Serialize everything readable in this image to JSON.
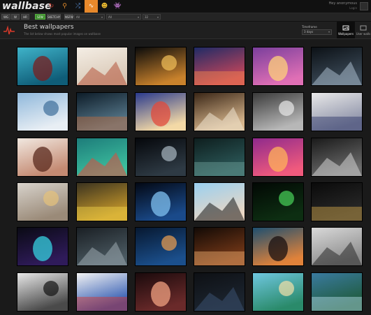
{
  "brand": {
    "logo": "wallbase"
  },
  "topbar": {
    "nav_icons": [
      {
        "name": "refresh-icon",
        "glyph": "↻",
        "color": "#c0392b"
      },
      {
        "name": "search-icon",
        "glyph": "⚲",
        "color": "#e08a2b"
      },
      {
        "name": "shuffle-icon",
        "glyph": "⤮",
        "color": "#5b8fd6"
      },
      {
        "name": "toplist-pulse-icon",
        "glyph": "∿",
        "color": "#ffffff",
        "active": true
      },
      {
        "name": "random-face-icon",
        "glyph": "☻",
        "color": "#e8b830"
      },
      {
        "name": "alien-icon",
        "glyph": "👾",
        "color": "#4fb04f"
      }
    ],
    "user": {
      "name": "Hey anonymous",
      "link": "Login"
    }
  },
  "filters": {
    "purity_buttons": [
      {
        "label": "WG",
        "on": false
      },
      {
        "label": "W",
        "on": false
      },
      {
        "label": "HR",
        "on": false
      },
      {
        "label": "SFW",
        "on": true
      },
      {
        "label": "SKETCHY",
        "on": true
      },
      {
        "label": "NSFW",
        "on": false
      }
    ],
    "selects": [
      {
        "label": "All",
        "name": "resolution-select"
      },
      {
        "label": "All",
        "name": "aspect-select"
      },
      {
        "label": "32",
        "name": "per-page-select"
      }
    ]
  },
  "header": {
    "title": "Best wallpapers",
    "subtitle": "The list below shows most popular images on wallbase",
    "timeframe_label": "Timeframe",
    "timeframe_value": "3 days",
    "tabs": [
      {
        "label": "Wallpapers",
        "active": true
      },
      {
        "label": "User walls",
        "active": false
      }
    ]
  },
  "thumbnails": [
    {
      "subject": "red-haired girl in pool",
      "c1": "#3fb3c9",
      "c2": "#0f5d78",
      "accent": "#7a1f1f"
    },
    {
      "subject": "red-haired girl lying in white",
      "c1": "#f4eee5",
      "c2": "#d9c8b6",
      "accent": "#b5533a"
    },
    {
      "subject": "golden clouds at sunset",
      "c1": "#0b0b0b",
      "c2": "#c9822c",
      "accent": "#f2c05a"
    },
    {
      "subject": "blue sea sunset with red sky",
      "c1": "#1f2b66",
      "c2": "#c9465a",
      "accent": "#f58a4b"
    },
    {
      "subject": "purple pink abstract sky",
      "c1": "#7a3f9c",
      "c2": "#e06fb5",
      "accent": "#ffd17a"
    },
    {
      "subject": "dark cityscape storm",
      "c1": "#0c1116",
      "c2": "#3d4c5a",
      "accent": "#a6b8c8"
    },
    {
      "subject": "snowy mountain range",
      "c1": "#8fb8db",
      "c2": "#e8eef4",
      "accent": "#3d6e9a"
    },
    {
      "subject": "chrome robot head",
      "c1": "#0d1c28",
      "c2": "#5b7d90",
      "accent": "#c06a3a"
    },
    {
      "subject": "beach cartoon scene",
      "c1": "#2a3a8c",
      "c2": "#f3d9a6",
      "accent": "#e24a3b"
    },
    {
      "subject": "fantasy blonde warrior",
      "c1": "#3a2616",
      "c2": "#d6b58c",
      "accent": "#efe4d0"
    },
    {
      "subject": "grey foggy city ruins",
      "c1": "#3a3a3a",
      "c2": "#b7b7b7",
      "accent": "#e8e8e8"
    },
    {
      "subject": "white armored knight",
      "c1": "#e9e9e9",
      "c2": "#8a8fa6",
      "accent": "#2a3266"
    },
    {
      "subject": "brunette girl",
      "c1": "#f1e8e0",
      "c2": "#c48a72",
      "accent": "#5a2a1e"
    },
    {
      "subject": "teal red feather leaves",
      "c1": "#1d7c7a",
      "c2": "#3dbf9e",
      "accent": "#e2493b"
    },
    {
      "subject": "astronaut helmet space",
      "c1": "#05070b",
      "c2": "#2e3a44",
      "accent": "#aab8c2"
    },
    {
      "subject": "dark dragon scene",
      "c1": "#0e1e1e",
      "c2": "#2c5a5a",
      "accent": "#6f9f9a"
    },
    {
      "subject": "magenta mountains sunset",
      "c1": "#8f2a8c",
      "c2": "#f05a7d",
      "accent": "#ffb35a"
    },
    {
      "subject": "black sports car",
      "c1": "#1a1a1a",
      "c2": "#6b6b6b",
      "accent": "#cfcfcf"
    },
    {
      "subject": "blonde girl on sofa",
      "c1": "#d8d3cc",
      "c2": "#9a8a78",
      "accent": "#e6c27a"
    },
    {
      "subject": "crowd of minions",
      "c1": "#3b3320",
      "c2": "#c99a2a",
      "accent": "#f0d24a"
    },
    {
      "subject": "blue galaxy spiral",
      "c1": "#030814",
      "c2": "#1a4a8a",
      "accent": "#7fc0f0"
    },
    {
      "subject": "girl with mouse ears",
      "c1": "#9ad0f0",
      "c2": "#e9d6c4",
      "accent": "#1a1a1a"
    },
    {
      "subject": "green matrix code",
      "c1": "#020804",
      "c2": "#0d2e12",
      "accent": "#49d35a"
    },
    {
      "subject": "daft punk helmets",
      "c1": "#0a0a0a",
      "c2": "#2a2a2a",
      "accent": "#d4a84a"
    },
    {
      "subject": "neon triangle logo",
      "c1": "#0a0a14",
      "c2": "#2f1b5a",
      "accent": "#35d0e0"
    },
    {
      "subject": "steampunk machinery",
      "c1": "#1a1f24",
      "c2": "#4b5a62",
      "accent": "#9aa8ae"
    },
    {
      "subject": "blue shattered figure",
      "c1": "#071830",
      "c2": "#1b4f8c",
      "accent": "#f0a050"
    },
    {
      "subject": "orange nebula space",
      "c1": "#120a06",
      "c2": "#7a3a18",
      "accent": "#f0b070"
    },
    {
      "subject": "desert road sunset",
      "c1": "#1e4f70",
      "c2": "#e0823a",
      "accent": "#1a1010"
    },
    {
      "subject": "robot cannon arm",
      "c1": "#d9d9d9",
      "c2": "#8c8c8c",
      "accent": "#2b2b2b"
    },
    {
      "subject": "girl at window",
      "c1": "#e8e8e8",
      "c2": "#4a4a4a",
      "accent": "#121212"
    },
    {
      "subject": "superman comic art",
      "c1": "#f3f3f3",
      "c2": "#2a55b0",
      "accent": "#d8332b"
    },
    {
      "subject": "bokeh night lights",
      "c1": "#1a0a0c",
      "c2": "#6a2a2a",
      "accent": "#f0a080"
    },
    {
      "subject": "dark blue minimal",
      "c1": "#0e1014",
      "c2": "#1c2530",
      "accent": "#3a5070"
    },
    {
      "subject": "tropical island lagoon",
      "c1": "#6fc7e0",
      "c2": "#2a8a6a",
      "accent": "#f3e0a8"
    },
    {
      "subject": "lake forest reflection",
      "c1": "#3a7aa0",
      "c2": "#1f5a3a",
      "accent": "#b8e0f0"
    }
  ]
}
